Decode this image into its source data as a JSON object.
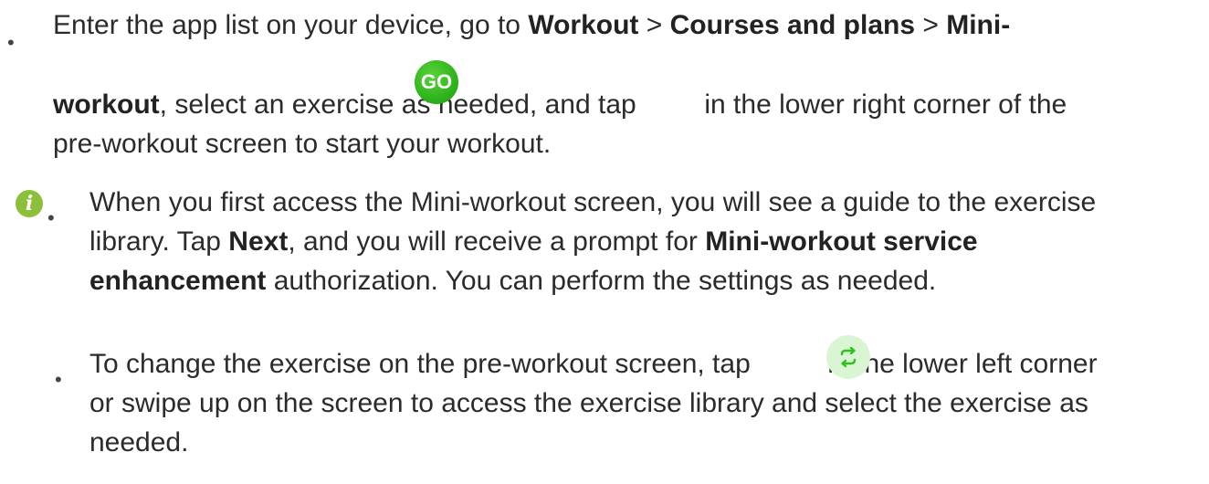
{
  "step1": {
    "l1_pre": "Enter the app list on your device, go to ",
    "workout": "Workout",
    "sep1": " > ",
    "courses": "Courses and plans",
    "sep2": " > ",
    "mini_a": "Mini-",
    "mini_b": "workout",
    "l2_mid": ", select an exercise as needed, and tap ",
    "go_label": "GO",
    "l2_post": " in the lower right corner of the",
    "l3": "pre-workout screen to start your workout."
  },
  "note1": {
    "l1": "When you first access the Mini-workout screen, you will see a guide to the exercise",
    "l2_pre": "library. Tap ",
    "next": "Next",
    "l2_mid": ", and you will receive a prompt for ",
    "service_a": "Mini-workout service",
    "service_b": "enhancement",
    "l3_post": " authorization. You can perform the settings as needed."
  },
  "note2": {
    "l1_pre": "To change the exercise on the pre-workout screen, tap ",
    "l1_post": " in the lower left corner",
    "l2": "or swipe up on the screen to access the exercise library and select the exercise as",
    "l3": "needed."
  },
  "bullet": "•",
  "icons": {
    "info": "info-icon",
    "go": "go-button-icon",
    "switch": "switch-exercise-icon"
  },
  "colors": {
    "go_green": "#2fb41c",
    "switch_bg": "#d9f5d4",
    "info_green": "#8cbf3a"
  }
}
